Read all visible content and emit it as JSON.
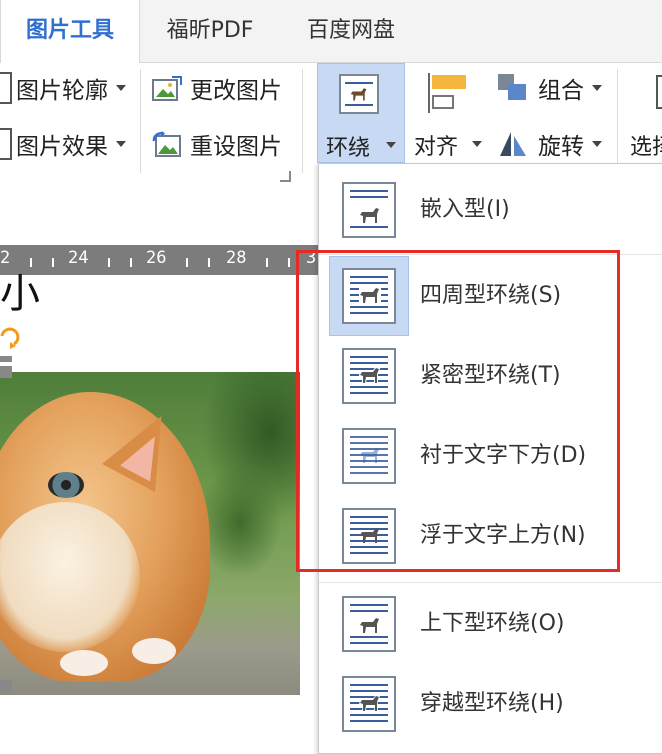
{
  "tabs": [
    {
      "label": "图片工具",
      "active": true
    },
    {
      "label": "福昕PDF",
      "active": false
    },
    {
      "label": "百度网盘",
      "active": false
    }
  ],
  "ribbon": {
    "outline": "图片轮廓",
    "effects": "图片效果",
    "change_picture": "更改图片",
    "reset_picture": "重设图片",
    "wrap": "环绕",
    "align": "对齐",
    "group": "组合",
    "rotate": "旋转",
    "select_partial": "选择"
  },
  "ruler": {
    "labels": [
      "2",
      "24",
      "26",
      "28",
      "3"
    ]
  },
  "doc_fragment": "小",
  "wrap_menu": {
    "items": [
      {
        "label": "嵌入型(I)",
        "icon": "inline-icon"
      },
      {
        "label": "四周型环绕(S)",
        "icon": "square-wrap-icon",
        "selected": true
      },
      {
        "label": "紧密型环绕(T)",
        "icon": "tight-wrap-icon"
      },
      {
        "label": "衬于文字下方(D)",
        "icon": "behind-text-icon"
      },
      {
        "label": "浮于文字上方(N)",
        "icon": "in-front-text-icon"
      },
      {
        "label": "上下型环绕(O)",
        "icon": "top-bottom-wrap-icon"
      },
      {
        "label": "穿越型环绕(H)",
        "icon": "through-wrap-icon"
      }
    ]
  },
  "colors": {
    "accent": "#2f6fd0",
    "highlight": "#c7d9f3",
    "annotation": "#e42b24"
  }
}
